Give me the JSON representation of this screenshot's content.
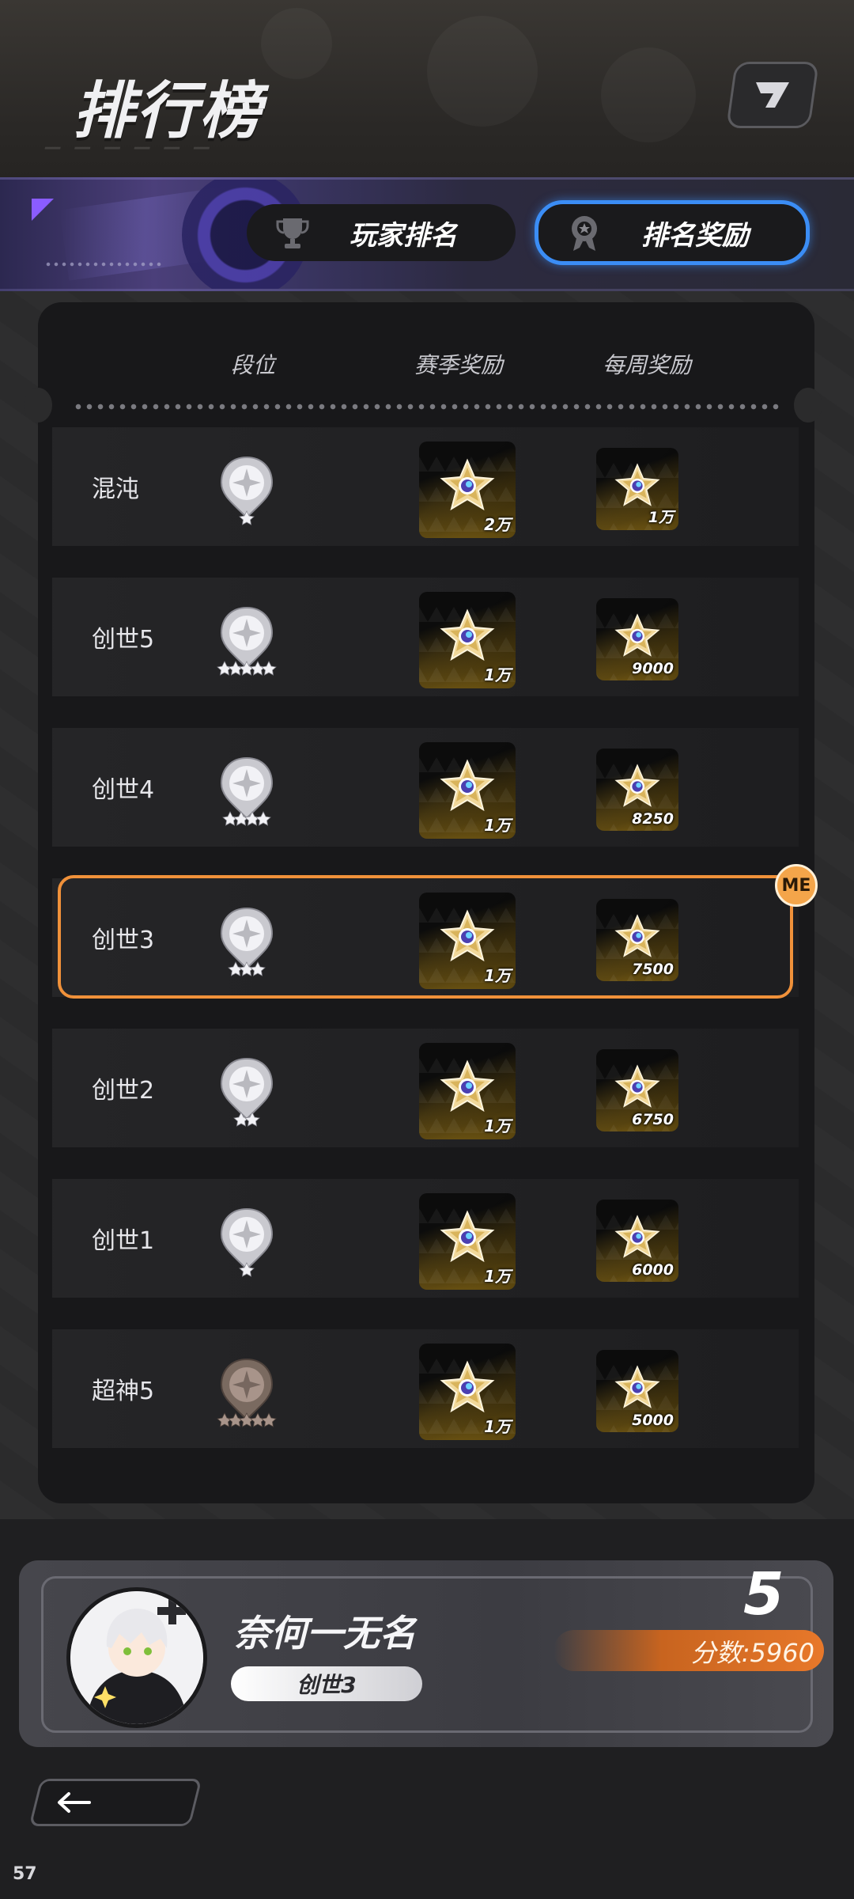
{
  "header": {
    "title": "排行榜",
    "corner_icon": "logo-mark-icon"
  },
  "tabs": [
    {
      "label": "玩家排名",
      "icon": "trophy-icon",
      "active": false
    },
    {
      "label": "排名奖励",
      "icon": "medal-icon",
      "active": true
    }
  ],
  "table": {
    "headers": {
      "rank": "段位",
      "season": "赛季奖励",
      "weekly": "每周奖励"
    },
    "rows": [
      {
        "name": "混沌",
        "badge_stars": 1,
        "badge_color": "silver",
        "season_reward": "2万",
        "weekly_reward": "1万",
        "me": false
      },
      {
        "name": "创世5",
        "badge_stars": 5,
        "badge_color": "silver",
        "season_reward": "1万",
        "weekly_reward": "9000",
        "me": false
      },
      {
        "name": "创世4",
        "badge_stars": 4,
        "badge_color": "silver",
        "season_reward": "1万",
        "weekly_reward": "8250",
        "me": false
      },
      {
        "name": "创世3",
        "badge_stars": 3,
        "badge_color": "silver",
        "season_reward": "1万",
        "weekly_reward": "7500",
        "me": true
      },
      {
        "name": "创世2",
        "badge_stars": 2,
        "badge_color": "silver",
        "season_reward": "1万",
        "weekly_reward": "6750",
        "me": false
      },
      {
        "name": "创世1",
        "badge_stars": 1,
        "badge_color": "silver",
        "season_reward": "1万",
        "weekly_reward": "6000",
        "me": false
      },
      {
        "name": "超神5",
        "badge_stars": 5,
        "badge_color": "bronze",
        "season_reward": "1万",
        "weekly_reward": "5000",
        "me": false
      }
    ],
    "me_badge": "ME",
    "me_highlight_color": "#f0913a"
  },
  "player": {
    "name": "奈何一无名",
    "rank": "创世3",
    "position": "5",
    "score_label": "分数:5960"
  },
  "footer": {
    "back_icon": "arrow-left-icon",
    "fps": "57"
  },
  "colors": {
    "active_tab_border": "#3b8df5",
    "score_bar": "#e8782a",
    "band_accent": "#8a5cff"
  }
}
